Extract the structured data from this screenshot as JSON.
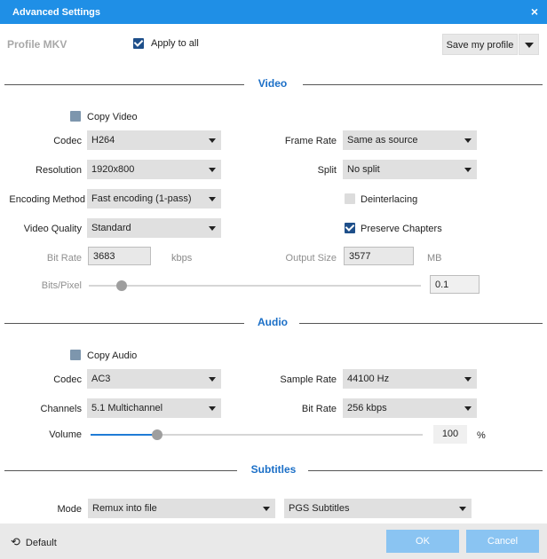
{
  "window": {
    "title": "Advanced Settings",
    "close_glyph": "×"
  },
  "profile": {
    "label": "Profile MKV"
  },
  "apply_all": {
    "label": "Apply to all",
    "checked": true
  },
  "save_profile": {
    "label": "Save my profile"
  },
  "video": {
    "heading": "Video",
    "copy_video": {
      "label": "Copy Video",
      "checked": false
    },
    "codec": {
      "label": "Codec",
      "value": "H264"
    },
    "resolution": {
      "label": "Resolution",
      "value": "1920x800"
    },
    "encoding_method": {
      "label": "Encoding Method",
      "value": "Fast encoding (1-pass)"
    },
    "video_quality": {
      "label": "Video Quality",
      "value": "Standard"
    },
    "bit_rate": {
      "label": "Bit Rate",
      "value": "3683",
      "unit": "kbps"
    },
    "bits_pixel": {
      "label": "Bits/Pixel",
      "value": "0.1",
      "level": 0.1
    },
    "frame_rate": {
      "label": "Frame Rate",
      "value": "Same as source"
    },
    "split": {
      "label": "Split",
      "value": "No split"
    },
    "deinterlacing": {
      "label": "Deinterlacing",
      "checked": false
    },
    "preserve_chapters": {
      "label": "Preserve Chapters",
      "checked": true
    },
    "output_size": {
      "label": "Output Size",
      "value": "3577",
      "unit": "MB"
    }
  },
  "audio": {
    "heading": "Audio",
    "copy_audio": {
      "label": "Copy Audio",
      "checked": false
    },
    "codec": {
      "label": "Codec",
      "value": "AC3"
    },
    "channels": {
      "label": "Channels",
      "value": "5.1 Multichannel"
    },
    "sample_rate": {
      "label": "Sample Rate",
      "value": "44100 Hz"
    },
    "bit_rate": {
      "label": "Bit Rate",
      "value": "256 kbps"
    },
    "volume": {
      "label": "Volume",
      "value": "100",
      "unit": "%",
      "level": 0.2
    }
  },
  "subtitles": {
    "heading": "Subtitles",
    "mode": {
      "label": "Mode",
      "value": "Remux into file"
    },
    "format": {
      "value": "PGS Subtitles"
    }
  },
  "footer": {
    "default_label": "Default",
    "ok_label": "OK",
    "cancel_label": "Cancel"
  },
  "colors": {
    "titlebar": "#1f8fe6",
    "accent": "#1b6fc7",
    "primary_button": "#8ac4f2",
    "checkbox": "#1e4f8a"
  }
}
